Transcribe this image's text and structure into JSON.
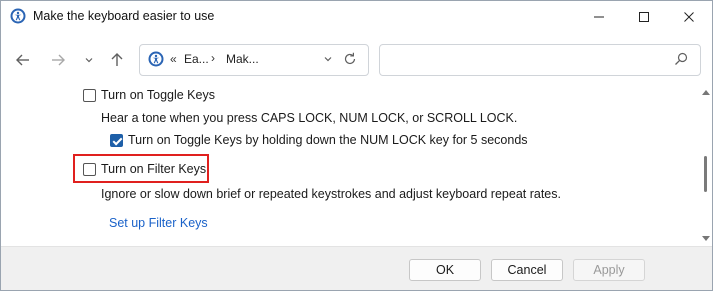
{
  "window": {
    "title": "Make the keyboard easier to use",
    "app_icon": "ease-of-access-icon",
    "controls": [
      "minimize-icon",
      "maximize-icon",
      "close-icon"
    ]
  },
  "nav": {
    "address": {
      "chevron": "«",
      "crumbs": [
        "Ea...",
        "Mak..."
      ],
      "separator": "›"
    },
    "search": {
      "placeholder": ""
    }
  },
  "content": {
    "toggle_keys": {
      "label": "Turn on Toggle Keys",
      "checked": false,
      "description": "Hear a tone when you press CAPS LOCK, NUM LOCK, or SCROLL LOCK.",
      "sub_option": {
        "label": "Turn on Toggle Keys by holding down the NUM LOCK key for 5 seconds",
        "checked": true
      }
    },
    "filter_keys": {
      "label": "Turn on Filter Keys",
      "checked": false,
      "highlighted": true,
      "description": "Ignore or slow down brief or repeated keystrokes and adjust keyboard repeat rates.",
      "setup_link": "Set up Filter Keys"
    }
  },
  "footer": {
    "ok_label": "OK",
    "cancel_label": "Cancel",
    "apply_label": "Apply",
    "apply_enabled": false
  },
  "colors": {
    "accent": "#1e5fa8",
    "link": "#1a62c9",
    "highlight_border": "#e0201e",
    "footer_bg": "#f0f0f0"
  }
}
